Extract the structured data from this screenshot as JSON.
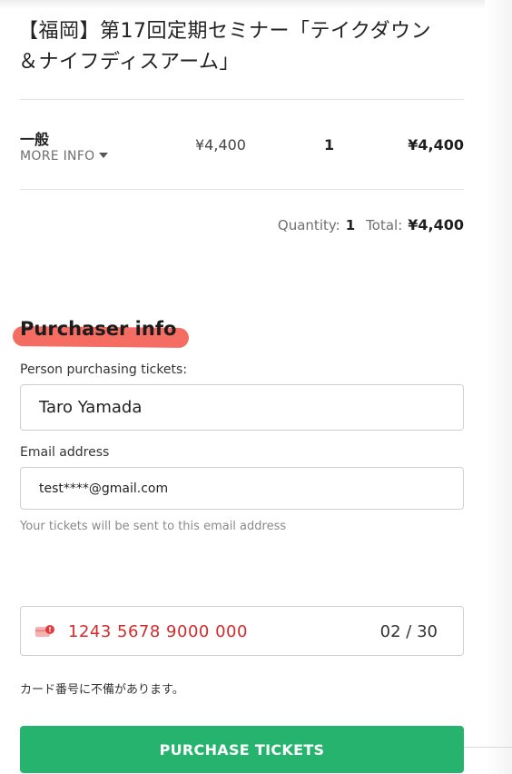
{
  "event": {
    "title_line1": "【福岡】第17回定期セミナー「テイクダウン",
    "title_line2": "＆ナイフディスアーム」"
  },
  "ticket": {
    "name": "一般",
    "more_info": "MORE INFO",
    "unit_price": "¥4,400",
    "quantity": "1",
    "line_total": "¥4,400"
  },
  "summary": {
    "quantity_label": "Quantity:",
    "quantity_value": "1",
    "total_label": "Total:",
    "total_value": "¥4,400"
  },
  "purchaser": {
    "section_title": "Purchaser info",
    "name_label": "Person purchasing tickets:",
    "name_value": "Taro Yamada",
    "email_label": "Email address",
    "email_value": "test****@gmail.com",
    "email_hint": "Your tickets will be sent to this email address"
  },
  "card": {
    "number": "1243 5678 9000 000",
    "expiry": "02 / 30",
    "icon": "card-error-icon",
    "error_message": "カード番号に不備があります。"
  },
  "actions": {
    "purchase_label": "PURCHASE TICKETS"
  },
  "colors": {
    "accent_green": "#26b36d",
    "error_red": "#d32b2b",
    "highlight": "#f35f55"
  }
}
